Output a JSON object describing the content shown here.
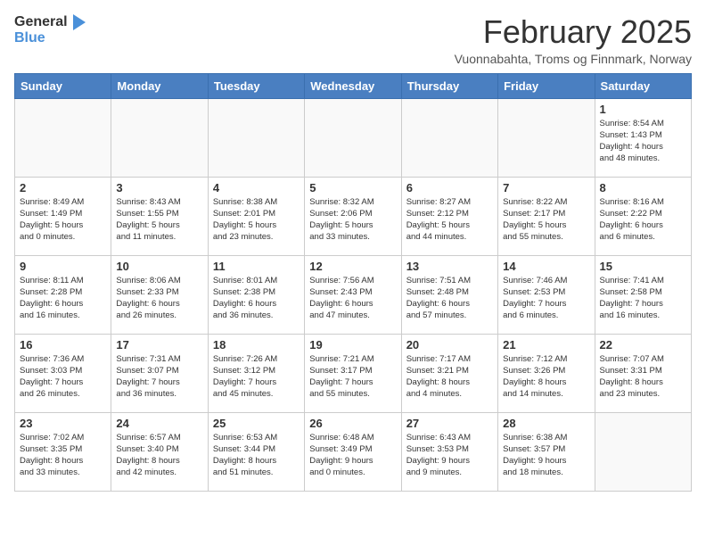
{
  "logo": {
    "general": "General",
    "blue": "Blue"
  },
  "title": "February 2025",
  "subtitle": "Vuonnabahta, Troms og Finnmark, Norway",
  "weekdays": [
    "Sunday",
    "Monday",
    "Tuesday",
    "Wednesday",
    "Thursday",
    "Friday",
    "Saturday"
  ],
  "weeks": [
    [
      {
        "day": "",
        "info": ""
      },
      {
        "day": "",
        "info": ""
      },
      {
        "day": "",
        "info": ""
      },
      {
        "day": "",
        "info": ""
      },
      {
        "day": "",
        "info": ""
      },
      {
        "day": "",
        "info": ""
      },
      {
        "day": "1",
        "info": "Sunrise: 8:54 AM\nSunset: 1:43 PM\nDaylight: 4 hours\nand 48 minutes."
      }
    ],
    [
      {
        "day": "2",
        "info": "Sunrise: 8:49 AM\nSunset: 1:49 PM\nDaylight: 5 hours\nand 0 minutes."
      },
      {
        "day": "3",
        "info": "Sunrise: 8:43 AM\nSunset: 1:55 PM\nDaylight: 5 hours\nand 11 minutes."
      },
      {
        "day": "4",
        "info": "Sunrise: 8:38 AM\nSunset: 2:01 PM\nDaylight: 5 hours\nand 23 minutes."
      },
      {
        "day": "5",
        "info": "Sunrise: 8:32 AM\nSunset: 2:06 PM\nDaylight: 5 hours\nand 33 minutes."
      },
      {
        "day": "6",
        "info": "Sunrise: 8:27 AM\nSunset: 2:12 PM\nDaylight: 5 hours\nand 44 minutes."
      },
      {
        "day": "7",
        "info": "Sunrise: 8:22 AM\nSunset: 2:17 PM\nDaylight: 5 hours\nand 55 minutes."
      },
      {
        "day": "8",
        "info": "Sunrise: 8:16 AM\nSunset: 2:22 PM\nDaylight: 6 hours\nand 6 minutes."
      }
    ],
    [
      {
        "day": "9",
        "info": "Sunrise: 8:11 AM\nSunset: 2:28 PM\nDaylight: 6 hours\nand 16 minutes."
      },
      {
        "day": "10",
        "info": "Sunrise: 8:06 AM\nSunset: 2:33 PM\nDaylight: 6 hours\nand 26 minutes."
      },
      {
        "day": "11",
        "info": "Sunrise: 8:01 AM\nSunset: 2:38 PM\nDaylight: 6 hours\nand 36 minutes."
      },
      {
        "day": "12",
        "info": "Sunrise: 7:56 AM\nSunset: 2:43 PM\nDaylight: 6 hours\nand 47 minutes."
      },
      {
        "day": "13",
        "info": "Sunrise: 7:51 AM\nSunset: 2:48 PM\nDaylight: 6 hours\nand 57 minutes."
      },
      {
        "day": "14",
        "info": "Sunrise: 7:46 AM\nSunset: 2:53 PM\nDaylight: 7 hours\nand 6 minutes."
      },
      {
        "day": "15",
        "info": "Sunrise: 7:41 AM\nSunset: 2:58 PM\nDaylight: 7 hours\nand 16 minutes."
      }
    ],
    [
      {
        "day": "16",
        "info": "Sunrise: 7:36 AM\nSunset: 3:03 PM\nDaylight: 7 hours\nand 26 minutes."
      },
      {
        "day": "17",
        "info": "Sunrise: 7:31 AM\nSunset: 3:07 PM\nDaylight: 7 hours\nand 36 minutes."
      },
      {
        "day": "18",
        "info": "Sunrise: 7:26 AM\nSunset: 3:12 PM\nDaylight: 7 hours\nand 45 minutes."
      },
      {
        "day": "19",
        "info": "Sunrise: 7:21 AM\nSunset: 3:17 PM\nDaylight: 7 hours\nand 55 minutes."
      },
      {
        "day": "20",
        "info": "Sunrise: 7:17 AM\nSunset: 3:21 PM\nDaylight: 8 hours\nand 4 minutes."
      },
      {
        "day": "21",
        "info": "Sunrise: 7:12 AM\nSunset: 3:26 PM\nDaylight: 8 hours\nand 14 minutes."
      },
      {
        "day": "22",
        "info": "Sunrise: 7:07 AM\nSunset: 3:31 PM\nDaylight: 8 hours\nand 23 minutes."
      }
    ],
    [
      {
        "day": "23",
        "info": "Sunrise: 7:02 AM\nSunset: 3:35 PM\nDaylight: 8 hours\nand 33 minutes."
      },
      {
        "day": "24",
        "info": "Sunrise: 6:57 AM\nSunset: 3:40 PM\nDaylight: 8 hours\nand 42 minutes."
      },
      {
        "day": "25",
        "info": "Sunrise: 6:53 AM\nSunset: 3:44 PM\nDaylight: 8 hours\nand 51 minutes."
      },
      {
        "day": "26",
        "info": "Sunrise: 6:48 AM\nSunset: 3:49 PM\nDaylight: 9 hours\nand 0 minutes."
      },
      {
        "day": "27",
        "info": "Sunrise: 6:43 AM\nSunset: 3:53 PM\nDaylight: 9 hours\nand 9 minutes."
      },
      {
        "day": "28",
        "info": "Sunrise: 6:38 AM\nSunset: 3:57 PM\nDaylight: 9 hours\nand 18 minutes."
      },
      {
        "day": "",
        "info": ""
      }
    ]
  ]
}
